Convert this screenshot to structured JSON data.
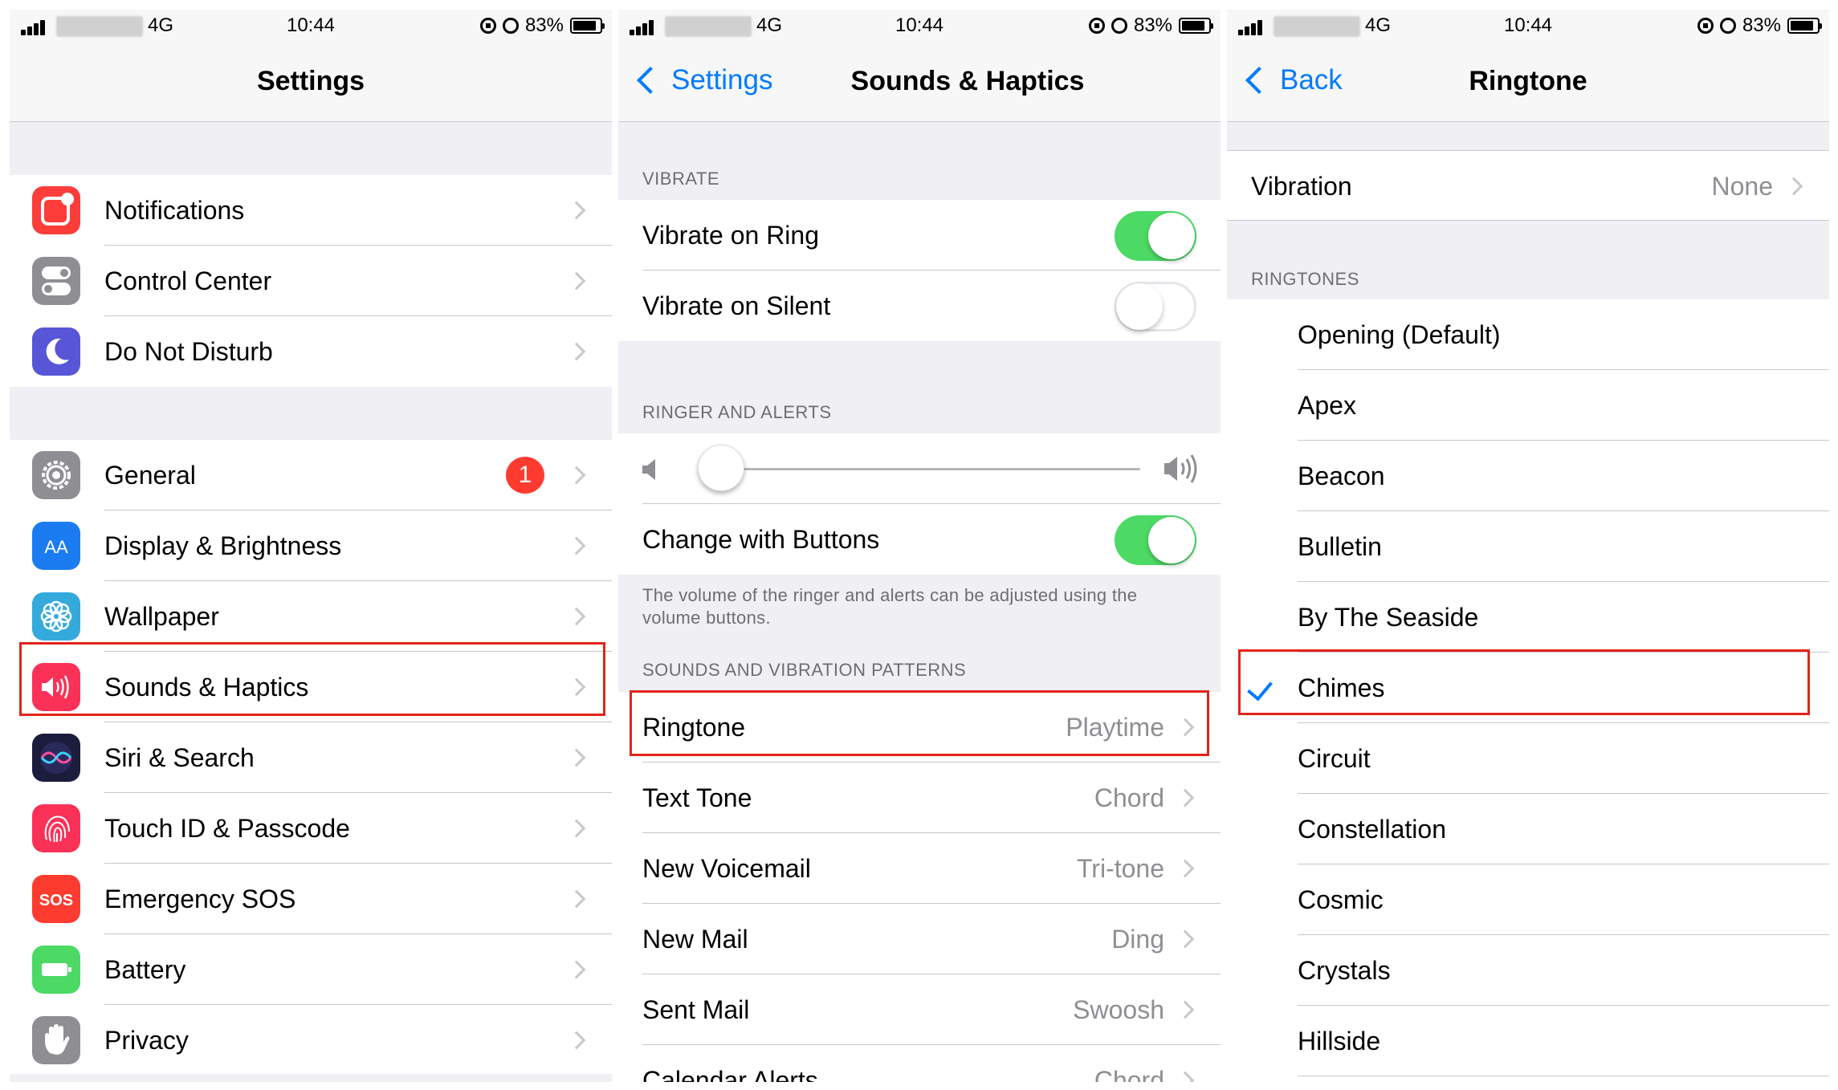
{
  "status_bar": {
    "network": "4G",
    "time": "10:44",
    "battery": "83%"
  },
  "colors": {
    "accent": "#007aff",
    "highlight": "#e2231a",
    "toggle_on": "#4cd964",
    "badge": "#ff3b30"
  },
  "settings": {
    "title": "Settings",
    "group1": [
      {
        "label": "Notifications",
        "icon": "notifications-icon",
        "color": "#fc3d39"
      },
      {
        "label": "Control Center",
        "icon": "control-center-icon",
        "color": "#8e8e93"
      },
      {
        "label": "Do Not Disturb",
        "icon": "moon-icon",
        "color": "#5856d6"
      }
    ],
    "group2": [
      {
        "label": "General",
        "icon": "gear-icon",
        "color": "#8e8e93",
        "badge": "1"
      },
      {
        "label": "Display & Brightness",
        "icon": "display-icon",
        "color": "#1b7cf2"
      },
      {
        "label": "Wallpaper",
        "icon": "wallpaper-icon",
        "color": "#34aadc"
      },
      {
        "label": "Sounds & Haptics",
        "icon": "speaker-icon",
        "color": "#fc3158"
      },
      {
        "label": "Siri & Search",
        "icon": "siri-icon",
        "color": "#1c1c3c"
      },
      {
        "label": "Touch ID & Passcode",
        "icon": "fingerprint-icon",
        "color": "#fc3158"
      },
      {
        "label": "Emergency SOS",
        "icon": "sos-icon",
        "color": "#fd3b2f"
      },
      {
        "label": "Battery",
        "icon": "battery-icon",
        "color": "#4cd964"
      },
      {
        "label": "Privacy",
        "icon": "hand-icon",
        "color": "#8e8e93"
      }
    ],
    "sos_text": "SOS",
    "display_text": "AA"
  },
  "sounds": {
    "back_label": "Settings",
    "title": "Sounds & Haptics",
    "vibrate_header": "VIBRATE",
    "vibrate_on_ring": {
      "label": "Vibrate on Ring",
      "on": true
    },
    "vibrate_on_silent": {
      "label": "Vibrate on Silent",
      "on": false
    },
    "ringer_header": "RINGER AND ALERTS",
    "ringer_volume": 0.05,
    "change_with_buttons": {
      "label": "Change with Buttons",
      "on": true
    },
    "ringer_note": "The volume of the ringer and alerts can be adjusted using the volume buttons.",
    "patterns_header": "SOUNDS AND VIBRATION PATTERNS",
    "patterns": [
      {
        "label": "Ringtone",
        "value": "Playtime"
      },
      {
        "label": "Text Tone",
        "value": "Chord"
      },
      {
        "label": "New Voicemail",
        "value": "Tri-tone"
      },
      {
        "label": "New Mail",
        "value": "Ding"
      },
      {
        "label": "Sent Mail",
        "value": "Swoosh"
      },
      {
        "label": "Calendar Alerts",
        "value": "Chord"
      }
    ]
  },
  "ringtone": {
    "back_label": "Back",
    "title": "Ringtone",
    "vibration": {
      "label": "Vibration",
      "value": "None"
    },
    "ringtones_header": "RINGTONES",
    "tones": [
      "Opening (Default)",
      "Apex",
      "Beacon",
      "Bulletin",
      "By The Seaside",
      "Chimes",
      "Circuit",
      "Constellation",
      "Cosmic",
      "Crystals",
      "Hillside"
    ],
    "selected": "Chimes"
  }
}
